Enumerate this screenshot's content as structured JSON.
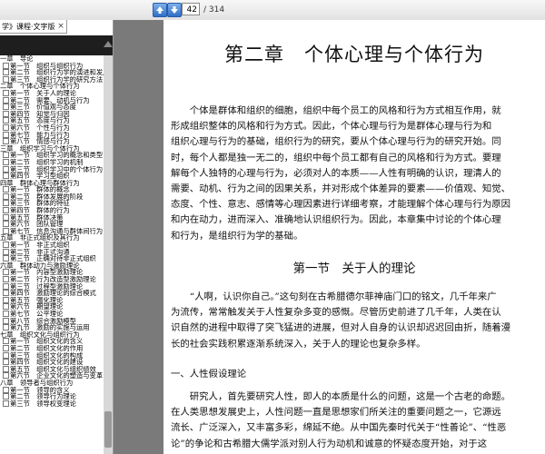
{
  "toolbar": {
    "current_page": "42",
    "total_pages": "/ 314"
  },
  "panel": {
    "tab_title": "学》课程·文字版",
    "close_glyph": "×"
  },
  "toc": [
    {
      "level": 0,
      "text": "一章　导论"
    },
    {
      "level": 1,
      "text": "第一节　组织与组织行为"
    },
    {
      "level": 1,
      "text": "第二节　组织行为学的演进和发展"
    },
    {
      "level": 1,
      "text": "第三节　组织行为学的研究方法"
    },
    {
      "level": 0,
      "text": "二章　个体心理与个体行为"
    },
    {
      "level": 1,
      "text": "第一节　关于人的理论"
    },
    {
      "level": 1,
      "text": "第二节　需要、动机与行为"
    },
    {
      "level": 1,
      "text": "第三节　价值观与态度"
    },
    {
      "level": 1,
      "text": "第四节　知觉与归因"
    },
    {
      "level": 1,
      "text": "第五节　态度与行为"
    },
    {
      "level": 1,
      "text": "第六节　个性与行为"
    },
    {
      "level": 1,
      "text": "第七节　能力与行为"
    },
    {
      "level": 1,
      "text": "第八节　情感与行为"
    },
    {
      "level": 0,
      "text": "三章　组织学习与个体行为"
    },
    {
      "level": 1,
      "text": "第一节　组织学习的概念和类型"
    },
    {
      "level": 1,
      "text": "第二节　组织学习的机制"
    },
    {
      "level": 1,
      "text": "第三节　组织学习中的个体行为"
    },
    {
      "level": 1,
      "text": "第四节　学习型组织"
    },
    {
      "level": 0,
      "text": "四章　群体心理与群体行为"
    },
    {
      "level": 1,
      "text": "第一节　群体的概念"
    },
    {
      "level": 1,
      "text": "第二节　群体发展的阶段"
    },
    {
      "level": 1,
      "text": "第三节　群体的特征"
    },
    {
      "level": 1,
      "text": "第四节　群体的行为"
    },
    {
      "level": 1,
      "text": "第五节　群体决策"
    },
    {
      "level": 1,
      "text": "第六节　团队管理"
    },
    {
      "level": 1,
      "text": "第七节　信息沟通与群体间行为"
    },
    {
      "level": 0,
      "text": "五章　非正式组织及其行为"
    },
    {
      "level": 1,
      "text": "第一节　非正式组织"
    },
    {
      "level": 1,
      "text": "第二节　非正式沟通"
    },
    {
      "level": 1,
      "text": "第三节　正确对待非正式组织"
    },
    {
      "level": 0,
      "text": "六章　群体动力与激励理论"
    },
    {
      "level": 1,
      "text": "第一节　内容型激励理论"
    },
    {
      "level": 1,
      "text": "第二节　行为改造型激励理论"
    },
    {
      "level": 1,
      "text": "第三节　过程型激励理论"
    },
    {
      "level": 1,
      "text": "第四节　激励理论的综合模式"
    },
    {
      "level": 1,
      "text": "第五节　强化理论"
    },
    {
      "level": 1,
      "text": "第六节　期望理论"
    },
    {
      "level": 1,
      "text": "第七节　公平理论"
    },
    {
      "level": 1,
      "text": "第八节　综合激励模型"
    },
    {
      "level": 1,
      "text": "第九节　激励的实施与运用"
    },
    {
      "level": 0,
      "text": "七章　组织文化与组织行为"
    },
    {
      "level": 1,
      "text": "第一节　组织文化的含义"
    },
    {
      "level": 1,
      "text": "第二节　组织文化的作用"
    },
    {
      "level": 1,
      "text": "第三节　组织文化的构成"
    },
    {
      "level": 1,
      "text": "第四节　组织文化的建设"
    },
    {
      "level": 1,
      "text": "第五节　组织文化与组织绩效"
    },
    {
      "level": 1,
      "text": "第六节　企业文化的塑造与变革"
    },
    {
      "level": 0,
      "text": "八章　领导者与组织行为"
    },
    {
      "level": 1,
      "text": "第一节　领导的含义"
    },
    {
      "level": 1,
      "text": "第二节　领导行为理论"
    },
    {
      "level": 1,
      "text": "第三节　领导权变理论"
    }
  ],
  "page": {
    "chapter_title": "第二章　个体心理与个体行为",
    "intro_lines": [
      "　　个体是群体和组织的细胞，组织中每个员工的风格和行为方式相互作用，就",
      "形成组织整体的风格和行为方式。因此，个体心理与行为是群体心理与行为和",
      "组织心理与行为的基础，组织行为的研究，要从个体心理与行为的研究开始。同",
      "时，每个人都是独一无二的，组织中每个员工都有自己的风格和行为方式。要理",
      "解每个人独特的心理与行为，必须对人的本质——人性有明确的认识，理清人的",
      "需要、动机、行为之间的因果关系，并对形成个体差异的要素——价值观、知觉、",
      "态度、个性、意志、感情等心理因素进行详细考察，才能理解个体心理与行为原因",
      "和内在动力，进而深入、准确地认识组织行为。因此，本章集中讨论的个体心理",
      "和行为，是组织行为学的基础。"
    ],
    "section_title": "第一节　关于人的理论",
    "section_lines": [
      "　　“人啊，认识你自己。”这句刻在古希腊德尔菲神庙门口的铭文，几千年来广",
      "为流传，常常触发关于人性复杂多变的感慨。尽管历史前进了几千年，人类在认",
      "识自然的进程中取得了突飞猛进的进展，但对人自身的认识却迟迟回由折，随着漫",
      "长的社会实践积累逐渐系统深入，关于人的理论也复杂多样。"
    ],
    "sub_heading": "一、人性假设理论",
    "last_lines": [
      "　　研究人，首先要研究人性，即人的本质是什么的问题，这是一个古老的命题。",
      "在人类思想发展史上，人性问题一直是思想家们所关注的重要问题之一，它源远",
      "流长、广泛深入，又丰富多彩，绵延不绝。从中国先秦时代关于“性善论”、“性恶",
      "论”的争论和古希腊大儒学派对别人行为动机和诚意的怀疑态度开始，对于这"
    ]
  },
  "colors": {
    "doc_background": "#7a7a7a",
    "panel_dark": "#1e1e1e",
    "nav_blue": "#2f6fc8"
  },
  "icons": [
    "arrow-up-icon",
    "arrow-down-icon",
    "close-icon",
    "collapse-triangle-icon",
    "toc-entry-icon"
  ]
}
